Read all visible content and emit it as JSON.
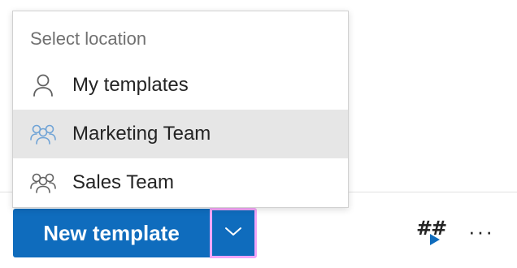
{
  "menu": {
    "header": "Select location",
    "items": [
      {
        "label": "My templates",
        "icon": "person-icon",
        "selected": false
      },
      {
        "label": "Marketing Team",
        "icon": "people-team-icon",
        "selected": true
      },
      {
        "label": "Sales Team",
        "icon": "people-team-icon",
        "selected": false
      }
    ]
  },
  "toolbar": {
    "new_template_label": "New template",
    "insert_field_glyph": "##",
    "more_glyph": "···"
  },
  "colors": {
    "primary": "#0f6cbd",
    "focus_outline": "#f3a6f8",
    "selected_row": "#e6e6e6",
    "team_icon": "#6fa3d6",
    "person_icon": "#616161"
  }
}
